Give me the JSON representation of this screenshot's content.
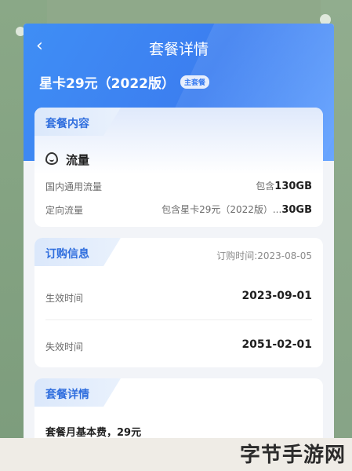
{
  "header": {
    "back_icon": "chevron-left-icon",
    "title": "套餐详情",
    "plan_name": "星卡29元（2022版）",
    "plan_badge": "主套餐"
  },
  "package_content": {
    "section_title": "套餐内容",
    "flow_title": "流量",
    "rows": [
      {
        "label": "国内通用流量",
        "value_prefix": "包含",
        "value": "130GB"
      },
      {
        "label": "定向流量",
        "value_prefix": "包含星卡29元（2022版）...",
        "value": "30GB"
      }
    ]
  },
  "order_info": {
    "section_title": "订购信息",
    "order_time": "订购时间:2023-08-05",
    "rows": [
      {
        "label": "生效时间",
        "value": "2023-09-01"
      },
      {
        "label": "失效时间",
        "value": "2051-02-01"
      }
    ]
  },
  "package_detail": {
    "section_title": "套餐详情",
    "line": "套餐月基本费，29元"
  },
  "watermark": "字节手游网",
  "colors": {
    "primary_blue": "#3c7ef0",
    "background_green": "#8fa98a"
  }
}
